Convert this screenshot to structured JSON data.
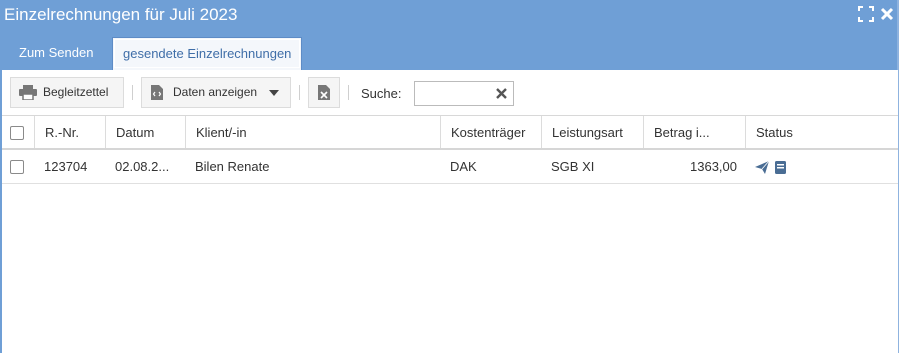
{
  "window": {
    "title": "Einzelrechnungen für Juli 2023",
    "maximize_icon": "maximize-icon",
    "close_icon": "close-icon"
  },
  "tabs": [
    {
      "label": "Zum Senden",
      "active": false
    },
    {
      "label": "gesendete Einzelrechnungen",
      "active": true
    }
  ],
  "toolbar": {
    "begleitzettel_label": "Begleitzettel",
    "begleitzettel_icon": "print-icon",
    "daten_label": "Daten anzeigen",
    "daten_icon": "code-file-icon",
    "excel_icon": "excel-icon",
    "search_label": "Suche:",
    "search_value": "",
    "search_clear_icon": "clear-icon"
  },
  "table": {
    "columns": [
      "",
      "R.-Nr.",
      "Datum",
      "Klient/-in",
      "Kostenträger",
      "Leistungsart",
      "Betrag i...",
      "Status"
    ],
    "rows": [
      {
        "checked": false,
        "rnr": "123704",
        "datum": "02.08.2...",
        "klient": "Bilen Renate",
        "kostentraeger": "DAK",
        "leistungsart": "SGB XI",
        "betrag": "1363,00",
        "status_icons": [
          "sent-icon",
          "book-icon"
        ]
      }
    ]
  },
  "colors": {
    "titlebar": "#6f9fd6",
    "active_tab_text": "#3f6ea8",
    "status_icon": "#4a6d94"
  }
}
